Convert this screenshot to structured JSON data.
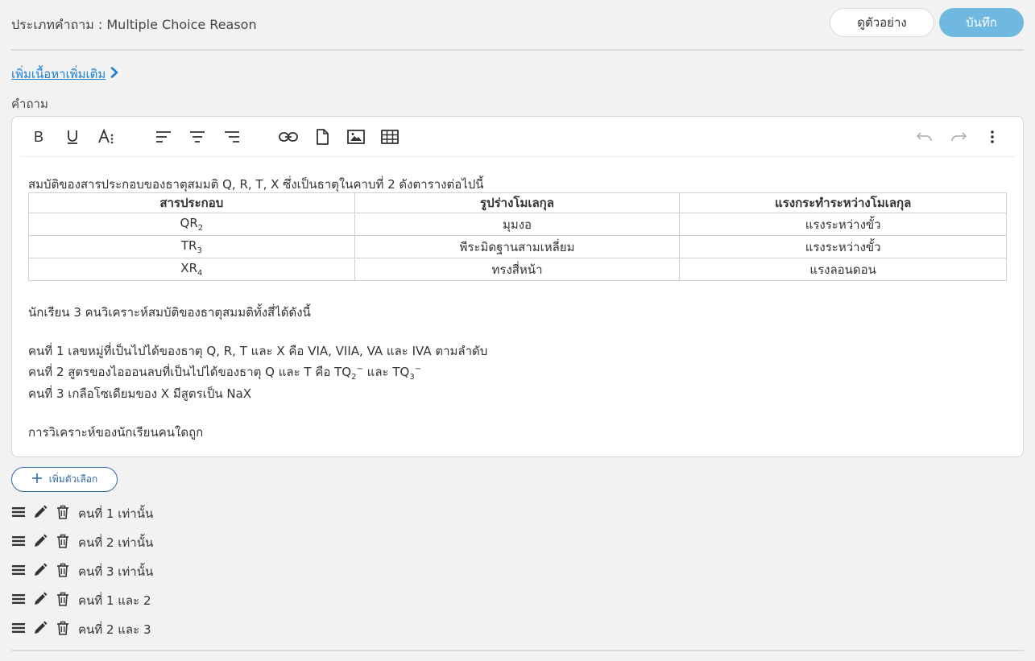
{
  "header": {
    "question_type": "ประเภทคำถาม : Multiple Choice Reason",
    "preview_label": "ดูตัวอย่าง",
    "save_label": "บันทึก"
  },
  "more_content_label": "เพิ่มเนื้อหาเพิ่มเติม",
  "question_label": "คำถาม",
  "toolbar": {
    "bold": "B",
    "underline": "U",
    "font_size": "A⁝",
    "icons": [
      "bold-icon",
      "underline-icon",
      "font-size-icon",
      "align-left-icon",
      "align-center-icon",
      "align-right-icon",
      "link-icon",
      "file-icon",
      "image-icon",
      "table-icon",
      "undo-icon",
      "redo-icon",
      "more-vertical-icon"
    ]
  },
  "content": {
    "intro": "สมบัติของสารประกอบของธาตุสมมติ Q, R, T, X ซึ่งเป็นธาตุในคาบที่ 2 ดังตารางต่อไปนี้",
    "table": {
      "headers": [
        "สารประกอบ",
        "รูปร่างโมเลกุล",
        "แรงกระทำระหว่างโมเลกุล"
      ],
      "rows": [
        {
          "base": "QR",
          "sub": "2",
          "shape": "มุมงอ",
          "force": "แรงระหว่างขั้ว"
        },
        {
          "base": "TR",
          "sub": "3",
          "shape": "พีระมิดฐานสามเหลี่ยม",
          "force": "แรงระหว่างขั้ว"
        },
        {
          "base": "XR",
          "sub": "4",
          "shape": "ทรงสี่หน้า",
          "force": "แรงลอนดอน"
        }
      ]
    },
    "students_intro": "นักเรียน 3 คนวิเคราะห์สมบัติของธาตุสมมติทั้งสี่ได้ดังนี้",
    "student1": "คนที่ 1 เลขหมู่ที่เป็นไปได้ของธาตุ Q, R, T และ X คือ VIA, VIIA, VA และ IVA ตามลำดับ",
    "student2": {
      "prefix": "คนที่ 2 สูตรของไอออนลบที่เป็นไปได้ของธาตุ Q และ T คือ TQ",
      "sub1": "2",
      "sup1": "−",
      "mid": " และ TQ",
      "sub2": "3",
      "sup2": "−"
    },
    "student3": "คนที่ 3 เกลือโซเดียมของ X มีสูตรเป็น NaX",
    "question": "การวิเคราะห์ของนักเรียนคนใดถูก"
  },
  "add_option_label": "เพิ่มตัวเลือก",
  "options": [
    {
      "label": "คนที่ 1 เท่านั้น"
    },
    {
      "label": "คนที่ 2 เท่านั้น"
    },
    {
      "label": "คนที่ 3 เท่านั้น"
    },
    {
      "label": "คนที่ 1 และ 2"
    },
    {
      "label": "คนที่ 2 และ 3"
    }
  ],
  "colors": {
    "primary": "#6fb9e0",
    "link": "#1a7fd4",
    "outline": "#2e6aa8",
    "background": "#f2f2f2"
  }
}
